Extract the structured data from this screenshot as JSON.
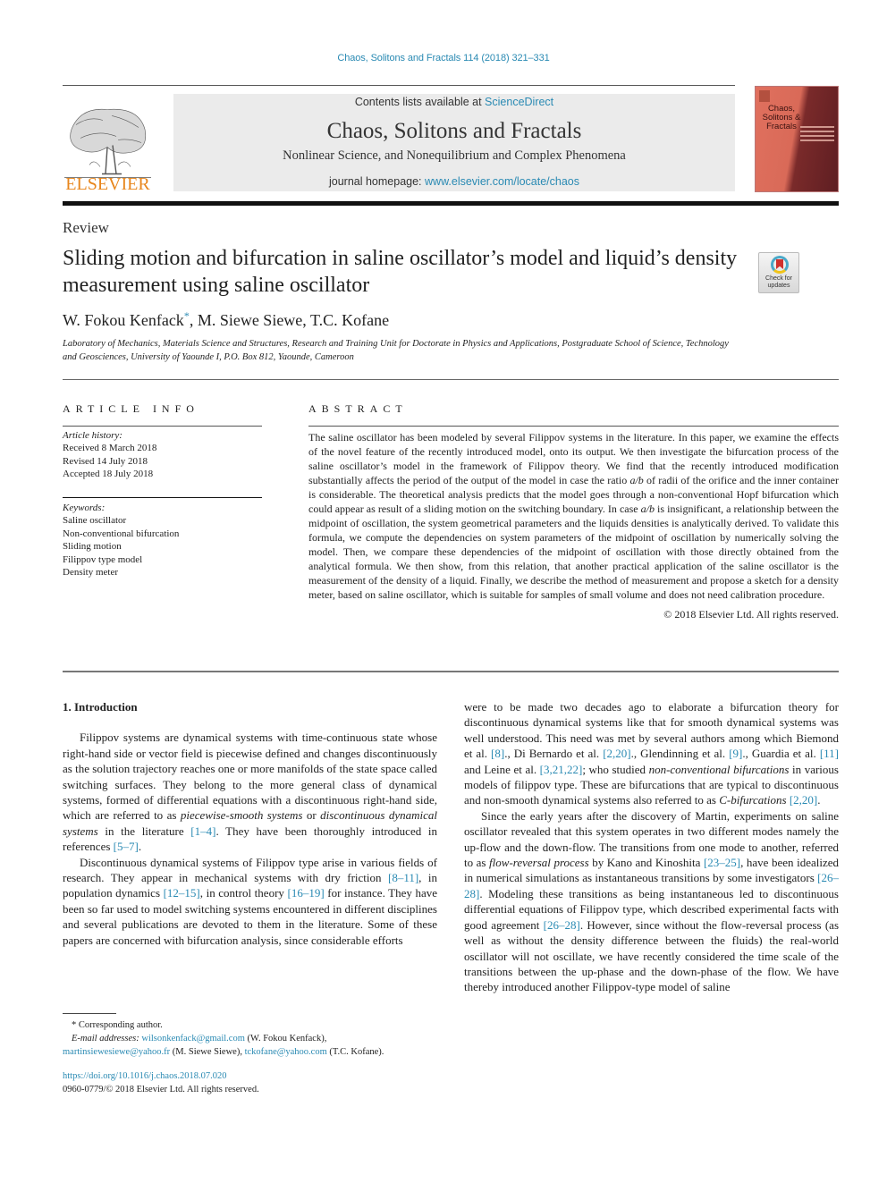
{
  "running_head": "Chaos, Solitons and Fractals 114 (2018) 321–331",
  "masthead": {
    "publisher": "ELSEVIER",
    "contents_prefix": "Contents lists available at ",
    "contents_link": "ScienceDirect",
    "journal_title": "Chaos, Solitons and Fractals",
    "journal_subtitle": "Nonlinear Science, and Nonequilibrium and Complex Phenomena",
    "homepage_prefix": "journal homepage: ",
    "homepage_link": "www.elsevier.com/locate/chaos",
    "cover_title": "Chaos, Solitons & Fractals"
  },
  "article": {
    "type": "Review",
    "title": "Sliding motion and bifurcation in saline oscillator’s model and liquid’s density measurement using saline oscillator",
    "check_updates": "Check for updates",
    "authors": [
      {
        "name": "W. Fokou Kenfack",
        "corresponding": true
      },
      {
        "name": "M. Siewe Siewe"
      },
      {
        "name": "T.C. Kofane"
      }
    ],
    "author_sep_1": ", ",
    "author_sep_2": ", ",
    "star": "*",
    "affiliation": "Laboratory of Mechanics, Materials Science and Structures, Research and Training Unit for Doctorate in Physics and Applications, Postgraduate School of Science, Technology and Geosciences, University of Yaounde I, P.O. Box 812, Yaounde, Cameroon"
  },
  "article_info": {
    "heading": "ARTICLE INFO",
    "history_label": "Article history:",
    "history": [
      "Received 8 March 2018",
      "Revised 14 July 2018",
      "Accepted 18 July 2018"
    ],
    "keywords_label": "Keywords:",
    "keywords": [
      "Saline oscillator",
      "Non-conventional bifurcation",
      "Sliding motion",
      "Filippov type model",
      "Density meter"
    ]
  },
  "abstract": {
    "heading": "ABSTRACT",
    "text_1": "The saline oscillator has been modeled by several Filippov systems in the literature. In this paper, we examine the effects of the novel feature of the recently introduced model, onto its output. We then investigate the bifurcation process of the saline oscillator’s model in the framework of Filippov theory. We find that the recently introduced modification substantially affects the period of the output of the model in case the ratio ",
    "ratio_1": "a/b",
    "text_2": " of radii of the orifice and the inner container is considerable. The theoretical analysis predicts that the model goes through a non-conventional Hopf bifurcation which could appear as result of a sliding motion on the switching boundary. In case ",
    "ratio_2": "a/b",
    "text_3": " is insignificant, a relationship between the midpoint of oscillation, the system geometrical parameters and the liquids densities is analytically derived. To validate this formula, we compute the dependencies on system parameters of the midpoint of oscillation by numerically solving the model. Then, we compare these dependencies of the midpoint of oscillation with those directly obtained from the analytical formula. We then show, from this relation, that another practical application of the saline oscillator is the measurement of the density of a liquid. Finally, we describe the method of measurement and propose a sketch for a density meter, based on saline oscillator, which is suitable for samples of small volume and does not need calibration procedure.",
    "copyright": "© 2018 Elsevier Ltd. All rights reserved."
  },
  "body": {
    "section_heading": "1.  Introduction",
    "left_p1": [
      {
        "t": "Filippov systems are dynamical systems with time-continuous state whose right-hand side or vector field is piecewise defined and changes discontinuously as the solution trajectory reaches one or more manifolds of the state space called switching surfaces. They belong to the more general class of dynamical systems, formed of differential equations with a discontinuous right-hand side, which are referred to as "
      },
      {
        "i": "piecewise-smooth systems"
      },
      {
        "t": " or "
      },
      {
        "i": "discontinuous dynamical systems"
      },
      {
        "t": " in the literature "
      },
      {
        "r": "[1–4]"
      },
      {
        "t": ". They have been thoroughly introduced in references "
      },
      {
        "r": "[5–7]"
      },
      {
        "t": "."
      }
    ],
    "left_p2": [
      {
        "t": "Discontinuous dynamical systems of Filippov type arise in various fields of research. They appear in mechanical systems with dry friction "
      },
      {
        "r": "[8–11]"
      },
      {
        "t": ", in population dynamics "
      },
      {
        "r": "[12–15]"
      },
      {
        "t": ", in control theory "
      },
      {
        "r": "[16–19]"
      },
      {
        "t": " for instance. They have been so far used to model switching systems encountered in different disciplines and several publications are devoted to them in the literature. Some of these papers are concerned with bifurcation analysis, since considerable efforts"
      }
    ],
    "right_p1": [
      {
        "t": "were to be made two decades ago to elaborate a bifurcation theory for discontinuous dynamical systems like that for smooth dynamical systems was well understood. This need was met by several authors among which Biemond et al. "
      },
      {
        "r": "[8]"
      },
      {
        "t": "., Di Bernardo et al. "
      },
      {
        "r": "[2,20]"
      },
      {
        "t": "., Glendinning et al. "
      },
      {
        "r": "[9]"
      },
      {
        "t": "., Guardia et al. "
      },
      {
        "r": "[11]"
      },
      {
        "t": " and Leine et al. "
      },
      {
        "r": "[3,21,22]"
      },
      {
        "t": "; who studied "
      },
      {
        "i": "non-conventional bifurcations"
      },
      {
        "t": " in various models of filippov type. These are bifurcations that are typical to discontinuous and non-smooth dynamical systems also referred to as "
      },
      {
        "i": "C-bifurcations"
      },
      {
        "t": " "
      },
      {
        "r": "[2,20]"
      },
      {
        "t": "."
      }
    ],
    "right_p2": [
      {
        "t": "Since the early years after the discovery of Martin, experiments on saline oscillator revealed that this system operates in two different modes namely the up-flow and the down-flow. The transitions from one mode to another, referred to as "
      },
      {
        "i": "flow-reversal process"
      },
      {
        "t": " by Kano and Kinoshita "
      },
      {
        "r": "[23–25]"
      },
      {
        "t": ", have been idealized in numerical simulations as instantaneous transitions by some investigators "
      },
      {
        "r": "[26–28]"
      },
      {
        "t": ". Modeling these transitions as being instantaneous led to discontinuous differential equations of Filippov type, which described experimental facts with good agreement "
      },
      {
        "r": "[26–28]"
      },
      {
        "t": ". However, since without the flow-reversal process (as well as without the density difference between the fluids) the real-world oscillator will not oscillate, we have recently considered the time scale of the transitions between the up-phase and the down-phase of the flow. We have thereby introduced another Filippov-type model of saline"
      }
    ]
  },
  "footnotes": {
    "corresponding": "* Corresponding author.",
    "email_label": "E-mail addresses: ",
    "emails": [
      {
        "address": "wilsonkenfack@gmail.com",
        "owner": " (W. Fokou Kenfack),"
      },
      {
        "address": "martinsiewesiewe@yahoo.fr",
        "owner": " (M. Siewe Siewe), "
      },
      {
        "address": "tckofane@yahoo.com",
        "owner": " (T.C. Kofane)."
      }
    ],
    "doi": "https://doi.org/10.1016/j.chaos.2018.07.020",
    "issn_copyright": "0960-0779/© 2018 Elsevier Ltd. All rights reserved."
  },
  "colors": {
    "link": "#2a8ab3",
    "elsevier_orange": "#e8861c",
    "masthead_bg": "#ebebeb"
  }
}
